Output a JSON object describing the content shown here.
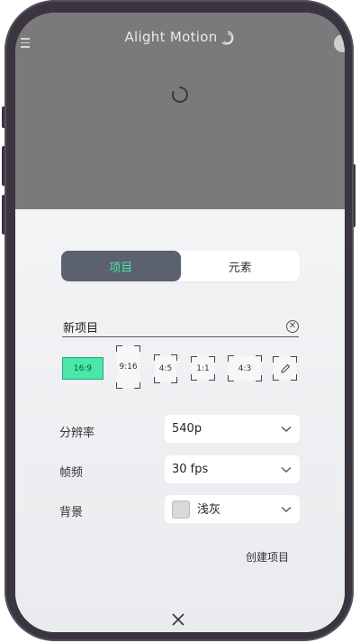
{
  "app": {
    "logo_text": "Alight Motion"
  },
  "tabs": [
    {
      "label": "项目",
      "active": true
    },
    {
      "label": "元素",
      "active": false
    }
  ],
  "project": {
    "name": "新项目"
  },
  "aspect_ratios": [
    {
      "label": "16:9",
      "selected": true
    },
    {
      "label": "9:16",
      "selected": false
    },
    {
      "label": "4:5",
      "selected": false
    },
    {
      "label": "1:1",
      "selected": false
    },
    {
      "label": "4:3",
      "selected": false
    },
    {
      "label": "custom",
      "icon": "pencil-icon",
      "selected": false
    }
  ],
  "settings": {
    "resolution": {
      "label": "分辨率",
      "value": "540p"
    },
    "framerate": {
      "label": "帧频",
      "value": "30 fps"
    },
    "background": {
      "label": "背景",
      "value": "浅灰",
      "swatch_color": "#d9d9d9"
    }
  },
  "actions": {
    "create_label": "创建项目"
  },
  "colors": {
    "accent": "#48e5a6",
    "tab_active_bg": "#5c6170",
    "header_bg": "#7a7a7a"
  }
}
